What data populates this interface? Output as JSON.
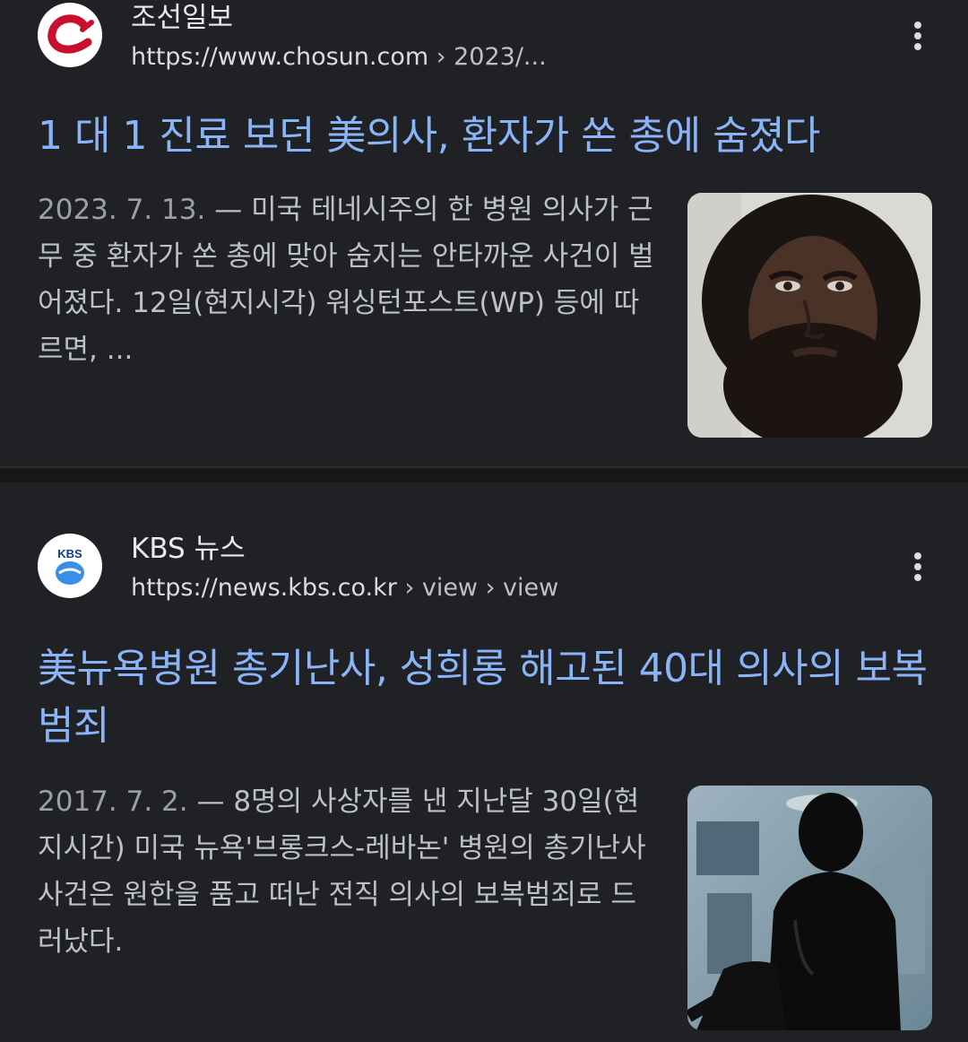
{
  "results": [
    {
      "source_name": "조선일보",
      "url_host": "https://www.chosun.com",
      "url_path": " › 2023/...",
      "title": "1 대 1 진료 보던 美의사, 환자가 쏜 총에 숨졌다",
      "date": "2023. 7. 13.",
      "dash": " — ",
      "snippet": "미국 테네시주의 한 병원 의사가 근무 중 환자가 쏜 총에 맞아 숨지는 안타까운 사건이 벌어졌다. 12일(현지시각) 워싱턴포스트(WP) 등에 따르면, ...",
      "favicon_icon": "chosun-logo-icon",
      "thumbnail_icon": "mugshot-photo",
      "accent": "#c8102e"
    },
    {
      "source_name": "KBS 뉴스",
      "url_host": "https://news.kbs.co.kr",
      "url_path": " › view › view",
      "title": "美뉴욕병원 총기난사, 성희롱 해고된 40대 의사의 보복 범죄",
      "date": "2017. 7. 2.",
      "dash": " — ",
      "snippet": "8명의 사상자를 낸 지난달 30일(현지시간) 미국 뉴욕'브롱크스-레바논' 병원의 총기난사 사건은 원한을 품고 떠난 전직 의사의 보복범죄로 드러났다.",
      "favicon_icon": "kbs-logo-icon",
      "favicon_text": "KBS",
      "thumbnail_icon": "doctor-silhouette-photo",
      "accent": "#1d6fd8"
    }
  ],
  "colors": {
    "background": "#202124",
    "title_link": "#8ab4f8",
    "snippet_text": "#bdc1c6"
  }
}
